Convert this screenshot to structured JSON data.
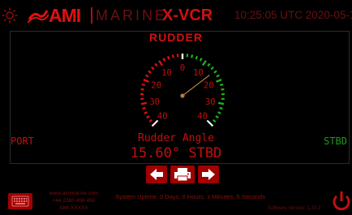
{
  "header": {
    "brand": "AMI",
    "brand_sub": "MARINE",
    "app_title": "X-VCR",
    "clock": "10:25:05 UTC 2020-05-14"
  },
  "gauge": {
    "title": "RUDDER",
    "port_label": "PORT",
    "stbd_label": "STBD",
    "ticks": [
      "40",
      "30",
      "20",
      "10",
      "0",
      "10",
      "20",
      "30",
      "40"
    ],
    "label": "Rudder Angle",
    "value_text": "15.60° STBD",
    "angle": 15.6,
    "range": [
      -40,
      40
    ],
    "port_color": "#e01010",
    "stbd_color": "#1fb01f"
  },
  "nav": {
    "prev_icon": "arrow-left-icon",
    "print_icon": "printer-icon",
    "next_icon": "arrow-right-icon"
  },
  "footer": {
    "keyboard_icon": "keyboard-icon",
    "site": "www.amimarine.com",
    "phone": "+44 2380 456 450",
    "code": "AMI-XXXXX",
    "uptime": "System Uptime: 0 Days, 0 Hours, 1 Minutes, 5 Seconds",
    "version": "Software Version: 1.33.3",
    "power_icon": "power-icon"
  },
  "colors": {
    "accent": "#d01010",
    "dark_red": "#6a1010",
    "button": "#a00000"
  }
}
